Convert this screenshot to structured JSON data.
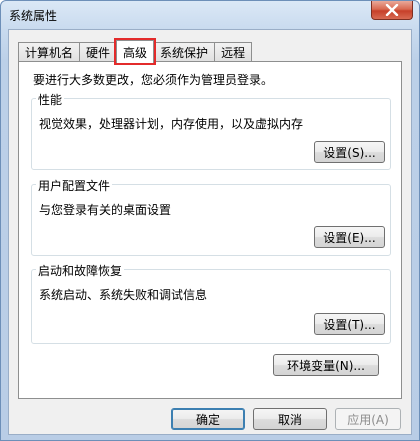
{
  "window": {
    "title": "系统属性"
  },
  "tabs": [
    {
      "label": "计算机名",
      "active": false
    },
    {
      "label": "硬件",
      "active": false
    },
    {
      "label": "高级",
      "active": true
    },
    {
      "label": "系统保护",
      "active": false
    },
    {
      "label": "远程",
      "active": false
    }
  ],
  "advanced": {
    "notice": "要进行大多数更改，您必须作为管理员登录。",
    "performance": {
      "title": "性能",
      "description": "视觉效果，处理器计划，内存使用，以及虚拟内存",
      "button": "设置(S)..."
    },
    "user_profiles": {
      "title": "用户配置文件",
      "description": "与您登录有关的桌面设置",
      "button": "设置(E)..."
    },
    "startup_recovery": {
      "title": "启动和故障恢复",
      "description": "系统启动、系统失败和调试信息",
      "button": "设置(T)..."
    },
    "env_button": "环境变量(N)..."
  },
  "footer": {
    "ok": "确定",
    "cancel": "取消",
    "apply": "应用(A)"
  },
  "colors": {
    "tab_highlight": "#e32b2b",
    "close_button": "#c7402a"
  },
  "icons": {
    "close": "close-icon"
  }
}
